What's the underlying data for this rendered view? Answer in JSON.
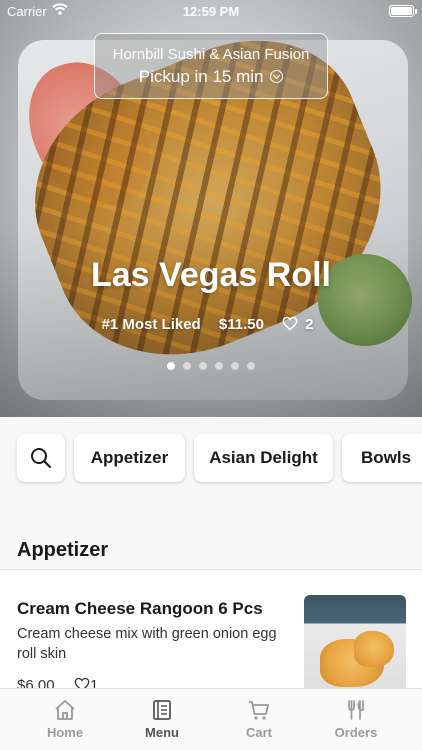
{
  "status_bar": {
    "carrier": "Carrier",
    "time": "12:59 PM"
  },
  "store": {
    "name": "Hornbill Sushi & Asian Fusion",
    "pickup": "Pickup in 15 min"
  },
  "featured": {
    "title": "Las Vegas Roll",
    "badge": "#1 Most Liked",
    "price": "$11.50",
    "likes": "2",
    "slides": 6,
    "active_slide": 1
  },
  "categories": [
    "Appetizer",
    "Asian Delight",
    "Bowls"
  ],
  "section": {
    "title": "Appetizer"
  },
  "item": {
    "name": "Cream Cheese Rangoon 6 Pcs",
    "description": "Cream cheese mix with green onion egg roll skin",
    "price": "$6.00",
    "likes": "1"
  },
  "tabs": [
    {
      "label": "Home",
      "icon": "home-icon"
    },
    {
      "label": "Menu",
      "icon": "menu-icon"
    },
    {
      "label": "Cart",
      "icon": "cart-icon"
    },
    {
      "label": "Orders",
      "icon": "orders-icon"
    }
  ],
  "colors": {
    "active_tab": "#555555",
    "inactive_tab": "#9a9a9a"
  }
}
